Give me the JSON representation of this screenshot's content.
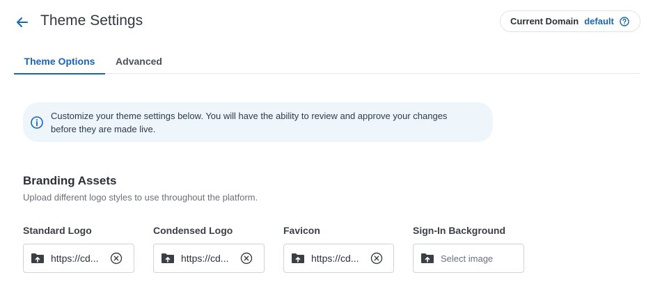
{
  "header": {
    "title": "Theme Settings",
    "back_icon": "arrow-left-icon",
    "domain_label": "Current Domain",
    "domain_value": "default",
    "help_icon": "question-circle-icon"
  },
  "tabs": [
    {
      "label": "Theme Options",
      "active": true
    },
    {
      "label": "Advanced",
      "active": false
    }
  ],
  "banner": {
    "icon": "info-icon",
    "line1": "Customize your theme settings below. You will have the ability to review and approve your changes",
    "line2": "before they are made live."
  },
  "branding": {
    "title": "Branding Assets",
    "description": "Upload different logo styles to use throughout the platform.",
    "fields": [
      {
        "label": "Standard Logo",
        "value": "https://cd...",
        "clearable": true
      },
      {
        "label": "Condensed Logo",
        "value": "https://cd...",
        "clearable": true
      },
      {
        "label": "Favicon",
        "value": "https://cd...",
        "clearable": true
      },
      {
        "label": "Sign-In Background",
        "placeholder": "Select image",
        "clearable": false
      }
    ]
  },
  "colors": {
    "accent": "#1864b5",
    "banner_bg": "#eef5fb",
    "border": "#cfd4da"
  }
}
